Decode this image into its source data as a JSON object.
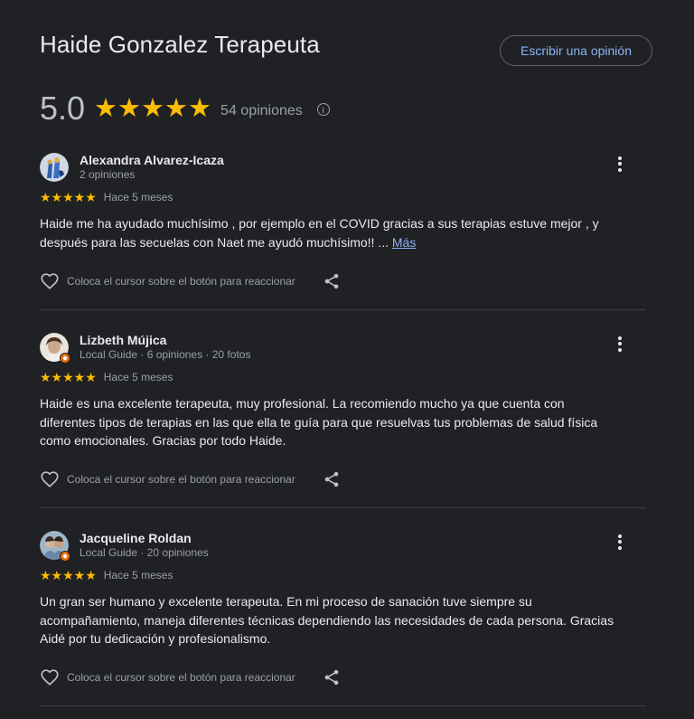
{
  "header": {
    "title": "Haide Gonzalez Terapeuta",
    "write_review_label": "Escribir una opinión"
  },
  "summary": {
    "rating": "5.0",
    "stars": "★★★★★",
    "rating_value": 5,
    "review_count_text": "54 opiniones",
    "info_icon": "info-icon"
  },
  "colors": {
    "background": "#202124",
    "star": "#fbbc04",
    "link": "#8ab4f8",
    "local_guide_badge": "#e8710a"
  },
  "reviews": [
    {
      "name": "Alexandra Alvarez-Icaza",
      "meta": "2 opiniones",
      "stars": "★★★★★",
      "rating_value": 5,
      "date": "Hace 5 meses",
      "text": "Haide me ha ayudado muchísimo , por ejemplo en el COVID gracias a sus terapias estuve mejor , y después para las secuelas con Naet me ayudó muchísimo!! ...",
      "more_label": "Más",
      "reaction_hint": "Coloca el cursor sobre el botón para reaccionar",
      "local_guide": false
    },
    {
      "name": "Lizbeth Mújica",
      "meta": "Local Guide · 6 opiniones · 20 fotos",
      "stars": "★★★★★",
      "rating_value": 5,
      "date": "Hace 5 meses",
      "text": "Haide es una excelente terapeuta, muy profesional. La recomiendo mucho ya que cuenta con diferentes tipos de terapias en las que ella te guía para que resuelvas tus problemas de salud física como emocionales. Gracias por todo Haide.",
      "reaction_hint": "Coloca el cursor sobre el botón para reaccionar",
      "local_guide": true
    },
    {
      "name": "Jacqueline Roldan",
      "meta": "Local Guide · 20 opiniones",
      "stars": "★★★★★",
      "rating_value": 5,
      "date": "Hace 5 meses",
      "text": "Un gran ser humano y excelente terapeuta. En mi proceso de sanación tuve siempre su acompañamiento, maneja diferentes técnicas dependiendo las necesidades de cada persona. Gracias Aidé por tu dedicación y profesionalismo.",
      "reaction_hint": "Coloca el cursor sobre el botón para reaccionar",
      "local_guide": true
    }
  ]
}
